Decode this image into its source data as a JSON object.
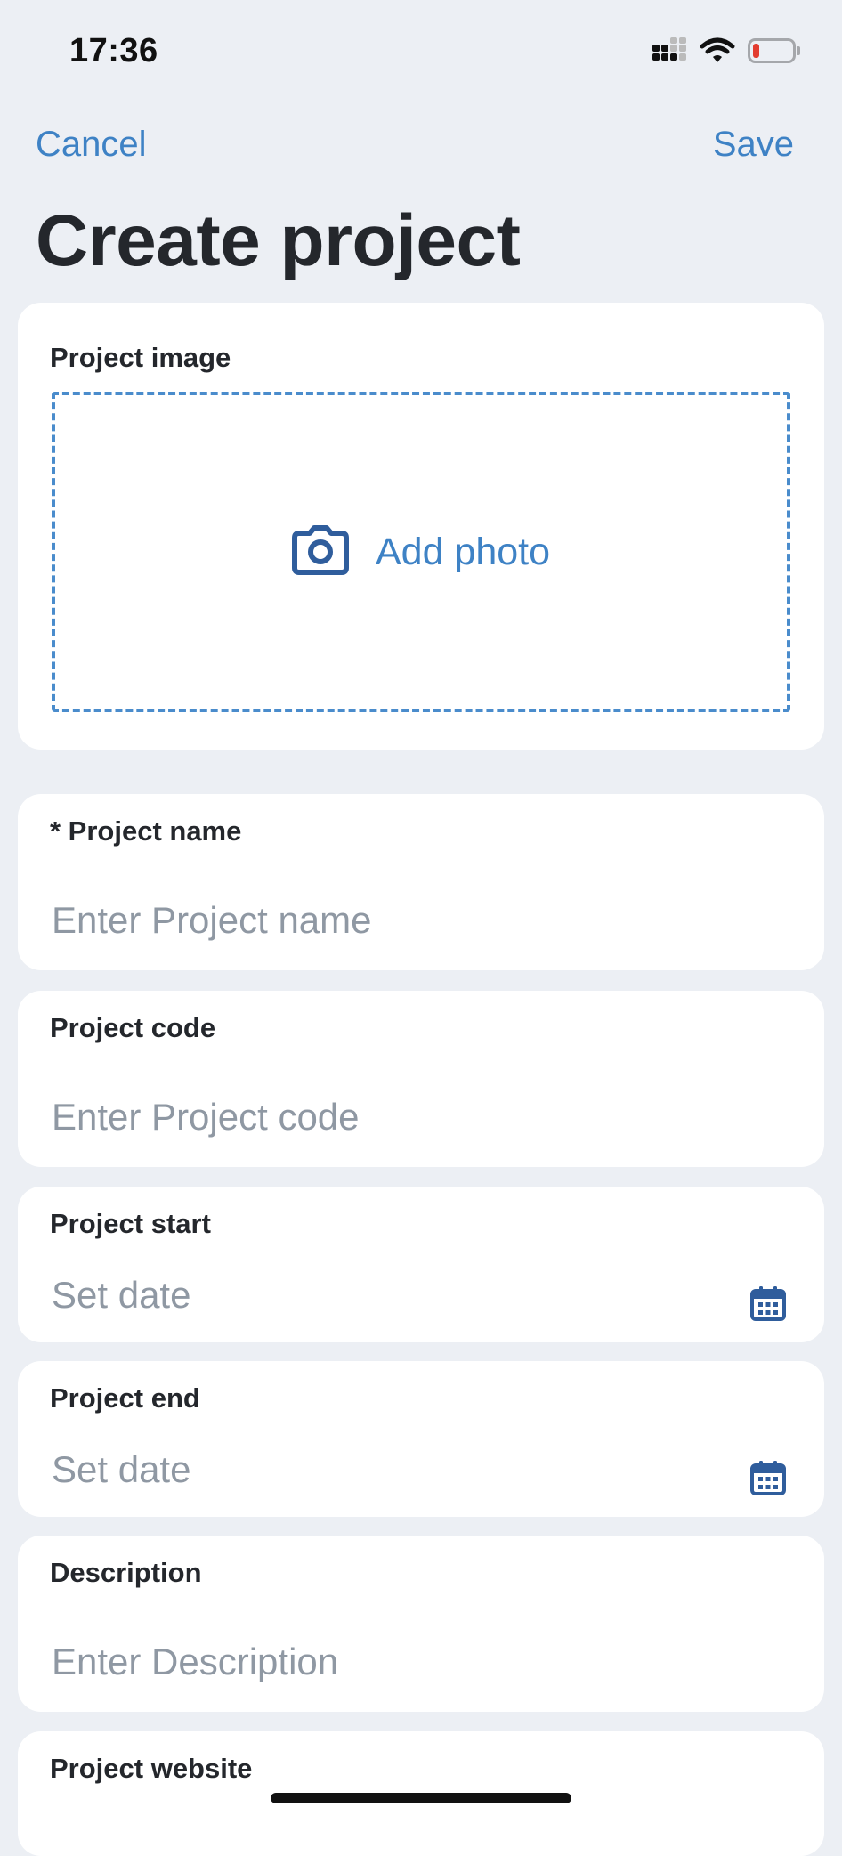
{
  "status_bar": {
    "time": "17:36",
    "icons": [
      "cellular-signal-icon",
      "wifi-icon",
      "battery-low-icon"
    ],
    "battery_color": "#e23c30"
  },
  "nav": {
    "cancel_label": "Cancel",
    "save_label": "Save",
    "accent_color": "#3e82c5"
  },
  "title": "Create project",
  "form": {
    "image": {
      "label": "Project image",
      "add_photo_label": "Add photo",
      "icon": "camera-icon"
    },
    "name": {
      "label": "* Project name",
      "placeholder": "Enter Project name",
      "value": ""
    },
    "code": {
      "label": "Project code",
      "placeholder": "Enter Project code",
      "value": ""
    },
    "start": {
      "label": "Project start",
      "placeholder": "Set date",
      "icon": "calendar-icon"
    },
    "end": {
      "label": "Project end",
      "placeholder": "Set date",
      "icon": "calendar-icon"
    },
    "description": {
      "label": "Description",
      "placeholder": "Enter Description",
      "value": ""
    },
    "website": {
      "label": "Project website"
    }
  }
}
